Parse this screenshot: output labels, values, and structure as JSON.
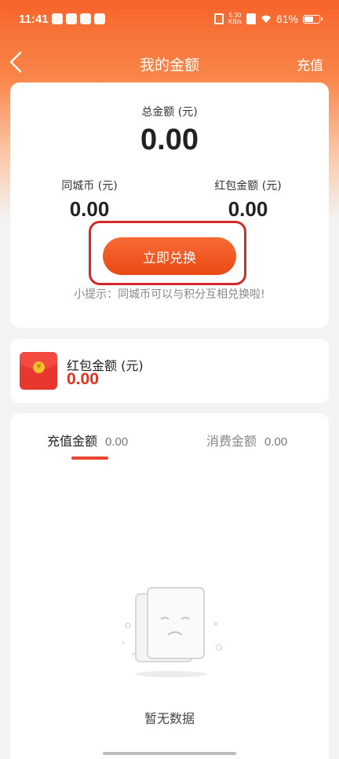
{
  "status_bar": {
    "time": "11:41",
    "net_speed_value": "5.30",
    "net_speed_unit": "KB/s",
    "battery": "61%"
  },
  "nav": {
    "title": "我的金额",
    "action": "充值"
  },
  "summary": {
    "total_label": "总金额 (元)",
    "total_value": "0.00",
    "coin_label": "同城币 (元)",
    "coin_value": "0.00",
    "redpacket_label": "红包金额 (元)",
    "redpacket_value": "0.00",
    "exchange_button": "立即兑换",
    "tip": "小提示：同城币可以与积分互相兑换啦!"
  },
  "red_packet_card": {
    "icon_symbol": "¥",
    "label": "红包金额  (元)",
    "value": "0.00"
  },
  "records": {
    "tabs": [
      {
        "label": "充值金额",
        "value": "0.00",
        "active": true
      },
      {
        "label": "消费金额",
        "value": "0.00",
        "active": false
      }
    ],
    "empty_text": "暂无数据"
  },
  "colors": {
    "accent": "#f76a35",
    "highlight_box": "#d72828",
    "red_value": "#e2321d"
  }
}
